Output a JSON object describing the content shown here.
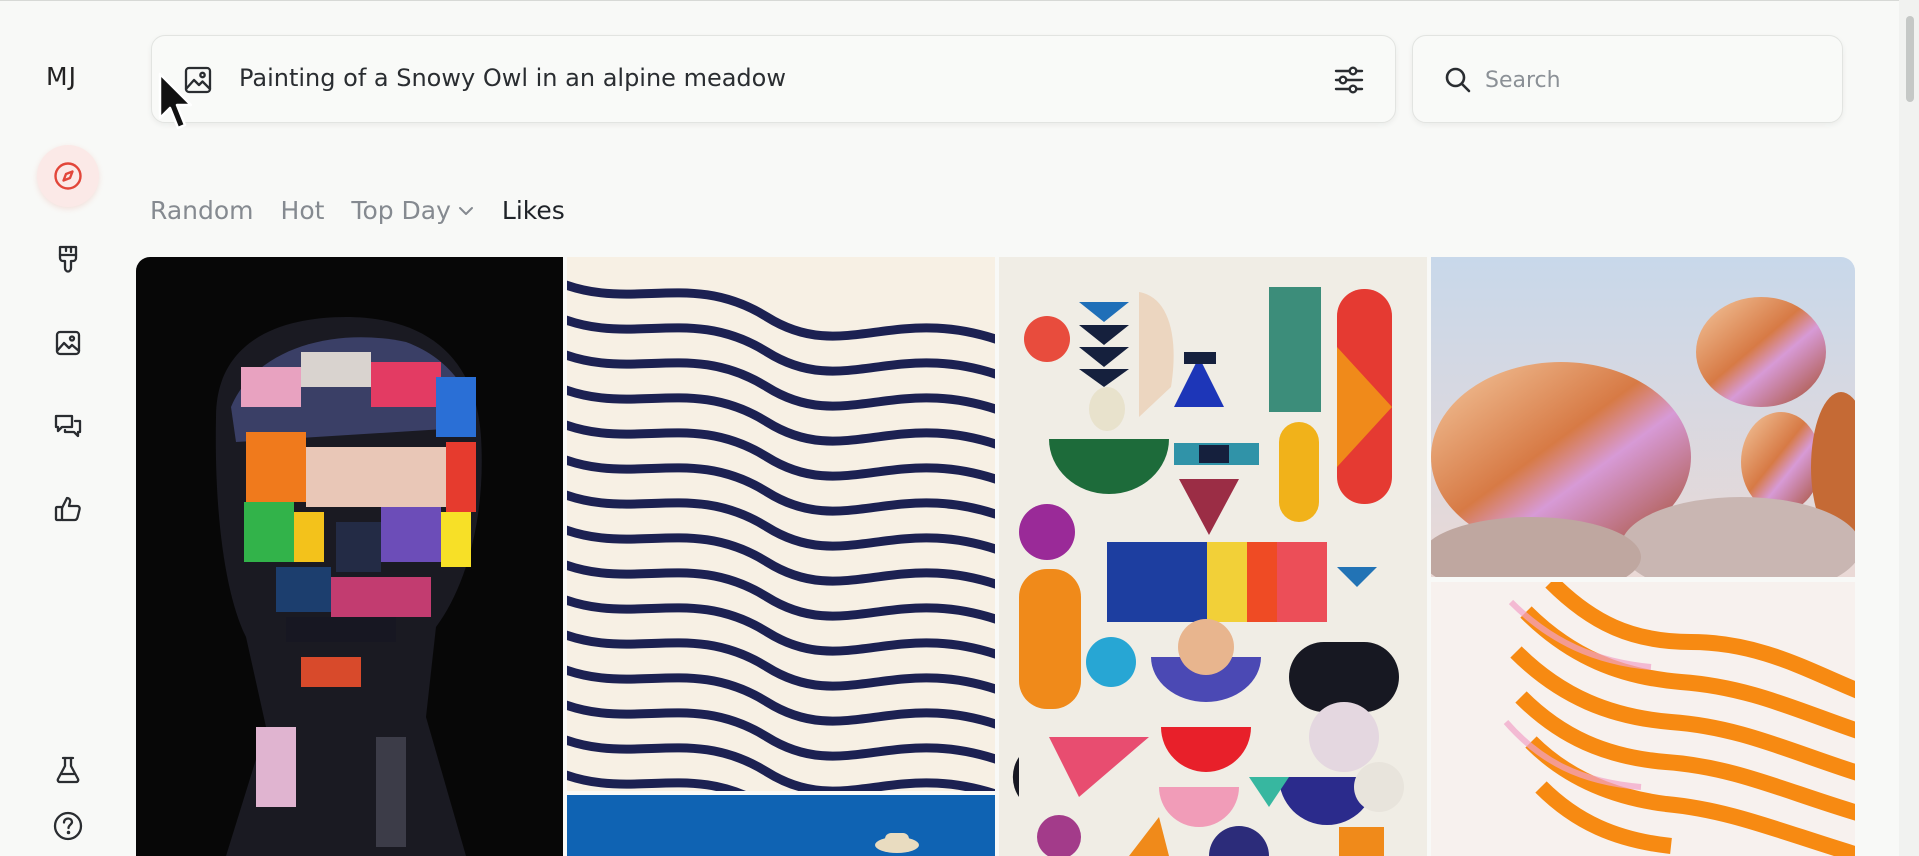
{
  "app": {
    "logo": "MJ"
  },
  "sidebar": {
    "items": [
      {
        "name": "explore",
        "icon": "compass-icon",
        "active": true
      },
      {
        "name": "create",
        "icon": "brush-icon",
        "active": false
      },
      {
        "name": "organize",
        "icon": "image-icon",
        "active": false
      },
      {
        "name": "chat",
        "icon": "chat-bubbles-icon",
        "active": false
      },
      {
        "name": "likes",
        "icon": "thumbs-up-icon",
        "active": false
      },
      {
        "name": "labs",
        "icon": "flask-icon",
        "active": false
      },
      {
        "name": "help",
        "icon": "help-circle-icon",
        "active": false
      }
    ]
  },
  "prompt_bar": {
    "text": "Painting of a Snowy Owl in an alpine meadow",
    "image_icon": "image-icon",
    "settings_icon": "sliders-icon"
  },
  "search": {
    "placeholder": "Search",
    "value": ""
  },
  "tabs": [
    {
      "label": "Random",
      "active": false
    },
    {
      "label": "Hot",
      "active": false
    },
    {
      "label": "Top Day",
      "active": false,
      "has_dropdown": true
    },
    {
      "label": "Likes",
      "active": true
    }
  ],
  "gallery": {
    "images": [
      {
        "name": "painted-face-portrait"
      },
      {
        "name": "navy-wave-lines"
      },
      {
        "name": "geometric-shapes-collage"
      },
      {
        "name": "iridescent-copper-stones"
      },
      {
        "name": "blue-sky-hat"
      },
      {
        "name": "orange-wave-stripes"
      }
    ]
  },
  "colors": {
    "accent": "#e2463a",
    "active_nav_bg": "#fbe9e7",
    "background": "#f8f9f7"
  }
}
